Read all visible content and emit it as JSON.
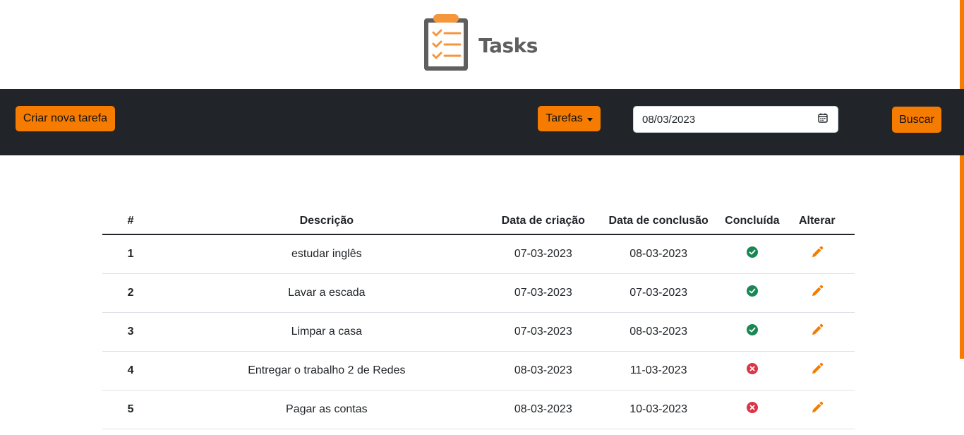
{
  "app": {
    "logo_text": "Tasks",
    "accent_color": "#f57c00",
    "nav_bg": "#212529"
  },
  "navbar": {
    "create_label": "Criar nova tarefa",
    "dropdown_label": "Tarefas",
    "date_value": "08/03/2023",
    "search_label": "Buscar"
  },
  "table": {
    "headers": {
      "num": "#",
      "desc": "Descrição",
      "created": "Data de criação",
      "done": "Data de conclusão",
      "status": "Concluída",
      "edit": "Alterar"
    },
    "rows": [
      {
        "num": "1",
        "desc": "estudar inglês",
        "created": "07-03-2023",
        "done": "08-03-2023",
        "completed": true
      },
      {
        "num": "2",
        "desc": "Lavar a escada",
        "created": "07-03-2023",
        "done": "07-03-2023",
        "completed": true
      },
      {
        "num": "3",
        "desc": "Limpar a casa",
        "created": "07-03-2023",
        "done": "08-03-2023",
        "completed": true
      },
      {
        "num": "4",
        "desc": "Entregar o trabalho 2 de Redes",
        "created": "08-03-2023",
        "done": "11-03-2023",
        "completed": false
      },
      {
        "num": "5",
        "desc": "Pagar as contas",
        "created": "08-03-2023",
        "done": "10-03-2023",
        "completed": false
      }
    ]
  },
  "icons": {
    "completed": "check-circle-icon",
    "not_completed": "x-circle-icon",
    "edit": "pencil-icon",
    "calendar": "calendar-icon",
    "logo": "clipboard-checklist-icon"
  },
  "colors": {
    "success": "#198754",
    "danger": "#dc3545",
    "edit": "#f57c00"
  }
}
